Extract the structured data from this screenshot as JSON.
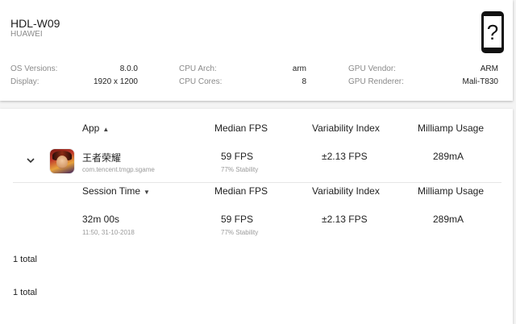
{
  "device": {
    "name": "HDL-W09",
    "brand": "HUAWEI",
    "icon": "unknown-phone-icon",
    "icon_glyph": "?",
    "specs": {
      "os_versions_label": "OS Versions:",
      "os_versions": "8.0.0",
      "display_label": "Display:",
      "display": "1920 x 1200",
      "cpu_arch_label": "CPU Arch:",
      "cpu_arch": "arm",
      "cpu_cores_label": "CPU Cores:",
      "cpu_cores": "8",
      "gpu_vendor_label": "GPU Vendor:",
      "gpu_vendor": "ARM",
      "gpu_renderer_label": "GPU Renderer:",
      "gpu_renderer": "Mali-T830"
    }
  },
  "apps_table": {
    "headers": {
      "app": "App",
      "median_fps": "Median FPS",
      "variability": "Variability Index",
      "milliamp": "Milliamp Usage"
    },
    "row": {
      "name": "王者荣耀",
      "package": "com.tencent.tmgp.sgame",
      "fps": "59 FPS",
      "stability": "77% Stability",
      "variability": "±2.13 FPS",
      "milliamp": "289mA"
    }
  },
  "sessions_table": {
    "headers": {
      "session_time": "Session Time",
      "median_fps": "Median FPS",
      "variability": "Variability Index",
      "milliamp": "Milliamp Usage"
    },
    "row": {
      "duration": "32m 00s",
      "timestamp": "11:50, 31-10-2018",
      "fps": "59 FPS",
      "stability": "77% Stability",
      "variability": "±2.13 FPS",
      "milliamp": "289mA"
    },
    "total": "1 total"
  },
  "apps_total": "1 total"
}
